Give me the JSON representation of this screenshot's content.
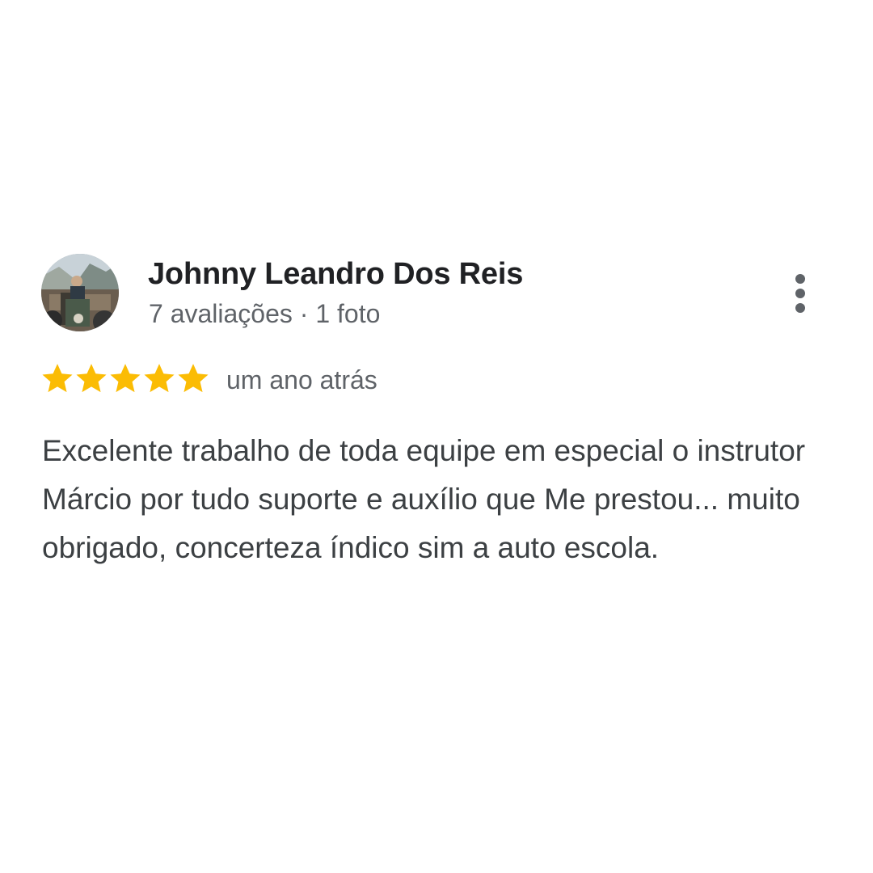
{
  "review": {
    "reviewer_name": "Johnny Leandro Dos Reis",
    "reviewer_meta": "7 avaliações · 1 foto",
    "rating": 5,
    "rating_max": 5,
    "star_color": "#fbbc04",
    "date": "um ano atrás",
    "text": "Excelente trabalho de toda equipe em especial o instrutor Márcio por tudo suporte e auxílio que Me prestou... muito obrigado, concerteza índico sim a auto escola.",
    "more_icon": "more-vert-icon",
    "avatar_icon": "profile-photo"
  }
}
